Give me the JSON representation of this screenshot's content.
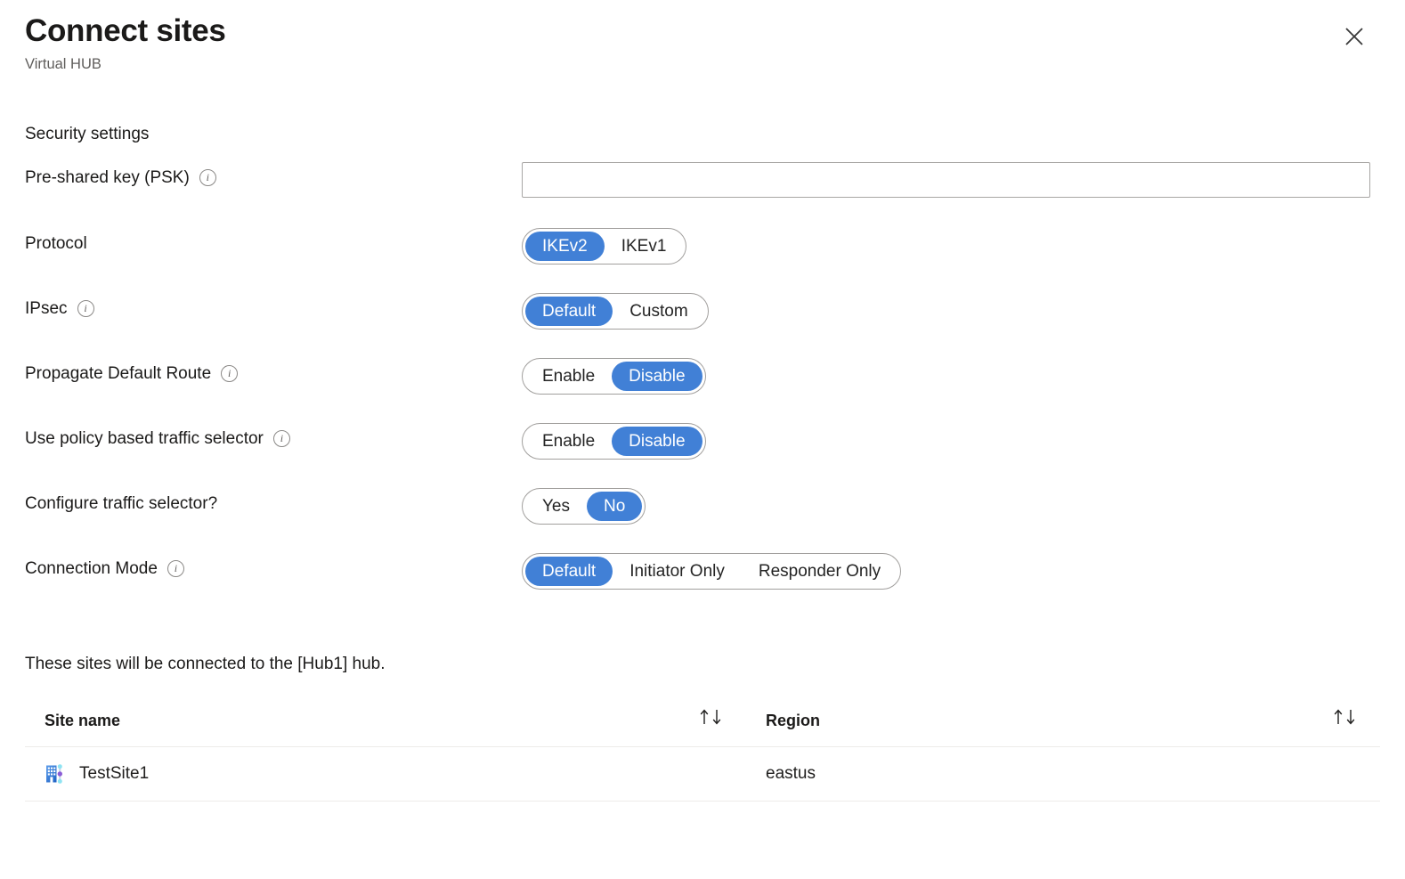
{
  "blade": {
    "title": "Connect sites",
    "subtitle": "Virtual HUB",
    "close_label": "Close",
    "close_icon": "close-icon"
  },
  "theme": {
    "accent_blue": "#4180d6",
    "selected_text": "#ffffff",
    "body_text": "#201f1e",
    "muted_text": "#605e5c",
    "border": "#a19f9d",
    "table_line": "#edebe9"
  },
  "form": {
    "section_title": "Security settings",
    "fields": [
      {
        "id": "psk",
        "label": "Pre-shared key (PSK)",
        "has_info": true,
        "info_icon": "info-icon",
        "type": "text",
        "value": "",
        "placeholder": ""
      },
      {
        "id": "protocol",
        "label": "Protocol",
        "has_info": false,
        "type": "pill",
        "options": [
          "IKEv2",
          "IKEv1"
        ],
        "selected": "IKEv2"
      },
      {
        "id": "ipsec",
        "label": "IPsec",
        "has_info": true,
        "info_icon": "info-icon",
        "type": "pill",
        "options": [
          "Default",
          "Custom"
        ],
        "selected": "Default"
      },
      {
        "id": "propagate-default-route",
        "label": "Propagate Default Route",
        "has_info": true,
        "info_icon": "info-icon",
        "type": "pill",
        "options": [
          "Enable",
          "Disable"
        ],
        "selected": "Disable"
      },
      {
        "id": "use-policy-based-traffic-selector",
        "label": "Use policy based traffic selector",
        "has_info": true,
        "info_icon": "info-icon",
        "type": "pill",
        "options": [
          "Enable",
          "Disable"
        ],
        "selected": "Disable"
      },
      {
        "id": "configure-traffic-selector",
        "label": "Configure traffic selector?",
        "has_info": false,
        "type": "pill",
        "options": [
          "Yes",
          "No"
        ],
        "selected": "No"
      },
      {
        "id": "connection-mode",
        "label": "Connection Mode",
        "has_info": true,
        "info_icon": "info-icon",
        "type": "pill",
        "options": [
          "Default",
          "Initiator Only",
          "Responder Only"
        ],
        "selected": "Default"
      }
    ]
  },
  "sites": {
    "note": "These sites will be connected to the [Hub1] hub.",
    "columns": [
      {
        "key": "site_name",
        "label": "Site name",
        "sortable": true,
        "sort_icon": "sort-updown-icon"
      },
      {
        "key": "region",
        "label": "Region",
        "sortable": true,
        "sort_icon": "sort-updown-icon"
      }
    ],
    "rows": [
      {
        "site_name": "TestSite1",
        "region": "eastus",
        "icon": "site-building-icon"
      }
    ]
  }
}
